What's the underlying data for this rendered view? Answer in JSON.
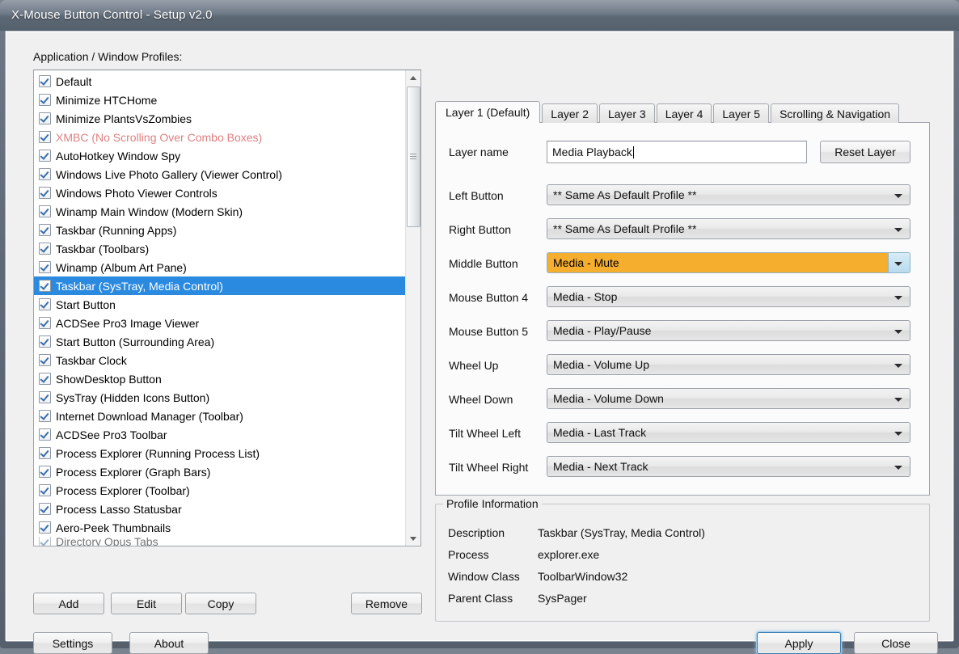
{
  "window": {
    "title": "X-Mouse Button Control - Setup v2.0"
  },
  "left_pane": {
    "label": "Application / Window Profiles:",
    "profiles": [
      {
        "name": "Default",
        "checked": true,
        "state": "normal"
      },
      {
        "name": "Minimize HTCHome",
        "checked": true,
        "state": "normal"
      },
      {
        "name": "Minimize PlantsVsZombies",
        "checked": true,
        "state": "normal"
      },
      {
        "name": "XMBC (No Scrolling Over Combo Boxes)",
        "checked": true,
        "state": "disabled-red"
      },
      {
        "name": "AutoHotkey Window Spy",
        "checked": true,
        "state": "normal"
      },
      {
        "name": "Windows Live Photo Gallery (Viewer Control)",
        "checked": true,
        "state": "normal"
      },
      {
        "name": "Windows Photo Viewer Controls",
        "checked": true,
        "state": "normal"
      },
      {
        "name": "Winamp Main Window (Modern Skin)",
        "checked": true,
        "state": "normal"
      },
      {
        "name": "Taskbar (Running Apps)",
        "checked": true,
        "state": "normal"
      },
      {
        "name": "Taskbar (Toolbars)",
        "checked": true,
        "state": "normal"
      },
      {
        "name": "Winamp (Album Art Pane)",
        "checked": true,
        "state": "normal"
      },
      {
        "name": "Taskbar (SysTray, Media Control)",
        "checked": true,
        "state": "selected"
      },
      {
        "name": "Start Button",
        "checked": true,
        "state": "normal"
      },
      {
        "name": "ACDSee Pro3 Image Viewer",
        "checked": true,
        "state": "normal"
      },
      {
        "name": "Start Button (Surrounding Area)",
        "checked": true,
        "state": "normal"
      },
      {
        "name": "Taskbar Clock",
        "checked": true,
        "state": "normal"
      },
      {
        "name": "ShowDesktop Button",
        "checked": true,
        "state": "normal"
      },
      {
        "name": "SysTray (Hidden Icons Button)",
        "checked": true,
        "state": "normal"
      },
      {
        "name": "Internet Download Manager (Toolbar)",
        "checked": true,
        "state": "normal"
      },
      {
        "name": "ACDSee Pro3 Toolbar",
        "checked": true,
        "state": "normal"
      },
      {
        "name": "Process Explorer (Running Process List)",
        "checked": true,
        "state": "normal"
      },
      {
        "name": "Process Explorer (Graph Bars)",
        "checked": true,
        "state": "normal"
      },
      {
        "name": "Process Explorer (Toolbar)",
        "checked": true,
        "state": "normal"
      },
      {
        "name": "Process Lasso Statusbar",
        "checked": true,
        "state": "normal"
      },
      {
        "name": "Aero-Peek Thumbnails",
        "checked": true,
        "state": "normal"
      },
      {
        "name": "Directory Opus Tabs",
        "checked": true,
        "state": "clipped"
      }
    ],
    "buttons": {
      "add": "Add",
      "edit": "Edit",
      "copy": "Copy",
      "remove": "Remove"
    }
  },
  "tabs": [
    {
      "label": "Layer 1 (Default)",
      "active": true
    },
    {
      "label": "Layer 2",
      "active": false
    },
    {
      "label": "Layer 3",
      "active": false
    },
    {
      "label": "Layer 4",
      "active": false
    },
    {
      "label": "Layer 5",
      "active": false
    },
    {
      "label": "Scrolling & Navigation",
      "active": false
    }
  ],
  "layer_panel": {
    "layer_name_label": "Layer name",
    "layer_name_value": "Media Playback",
    "reset_layer_label": "Reset Layer",
    "rows": [
      {
        "label": "Left Button",
        "value": "** Same As Default Profile **",
        "highlighted": false
      },
      {
        "label": "Right Button",
        "value": "** Same As Default Profile **",
        "highlighted": false
      },
      {
        "label": "Middle Button",
        "value": "Media - Mute",
        "highlighted": true
      },
      {
        "label": "Mouse Button 4",
        "value": "Media - Stop",
        "highlighted": false
      },
      {
        "label": "Mouse Button 5",
        "value": "Media - Play/Pause",
        "highlighted": false
      },
      {
        "label": "Wheel Up",
        "value": "Media - Volume Up",
        "highlighted": false
      },
      {
        "label": "Wheel Down",
        "value": "Media - Volume Down",
        "highlighted": false
      },
      {
        "label": "Tilt Wheel Left",
        "value": "Media - Last Track",
        "highlighted": false
      },
      {
        "label": "Tilt Wheel Right",
        "value": "Media - Next Track",
        "highlighted": false
      }
    ]
  },
  "profile_information": {
    "legend": "Profile Information",
    "fields": [
      {
        "label": "Description",
        "value": "Taskbar (SysTray, Media Control)"
      },
      {
        "label": "Process",
        "value": "explorer.exe"
      },
      {
        "label": "Window Class",
        "value": "ToolbarWindow32"
      },
      {
        "label": "Parent Class",
        "value": "SysPager"
      }
    ]
  },
  "footer": {
    "settings": "Settings",
    "about": "About",
    "apply": "Apply",
    "close": "Close"
  },
  "colors": {
    "highlight_combo": "#f5ae2e",
    "selection_blue": "#2a8ae0",
    "disabled_red": "#e08080",
    "titlebar_dark": "#5d6875"
  }
}
